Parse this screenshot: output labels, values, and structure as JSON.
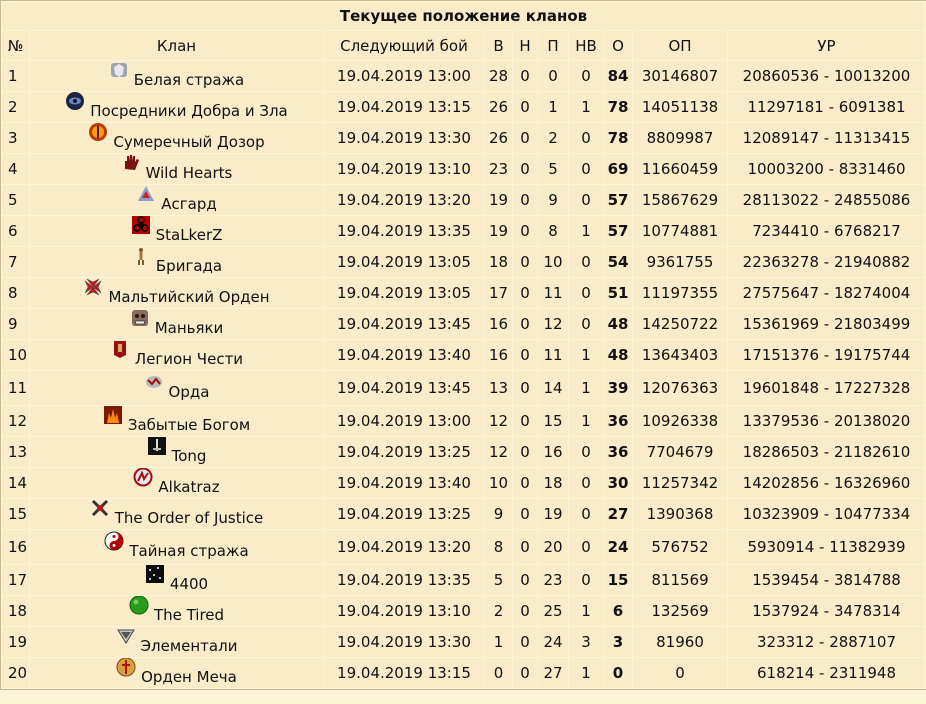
{
  "title": "Текущее положение кланов",
  "headers": [
    "№",
    "Клан",
    "Следующий бой",
    "В",
    "Н",
    "П",
    "НВ",
    "О",
    "ОП",
    "УР"
  ],
  "rows": [
    {
      "n": "1",
      "icon": "shield-icon",
      "clan": "Белая стража",
      "date": "19.04.2019 13:00",
      "w": "28",
      "d": "0",
      "l": "0",
      "nv": "0",
      "o": "84",
      "op": "30146807",
      "ur": "20860536 - 10013200"
    },
    {
      "n": "2",
      "icon": "eye-icon",
      "clan": "Посредники Добра и Зла",
      "date": "19.04.2019 13:15",
      "w": "26",
      "d": "0",
      "l": "1",
      "nv": "1",
      "o": "78",
      "op": "14051138",
      "ur": "11297181 - 6091381"
    },
    {
      "n": "3",
      "icon": "flame-circle-icon",
      "clan": "Сумеречный Дозор",
      "date": "19.04.2019 13:30",
      "w": "26",
      "d": "0",
      "l": "2",
      "nv": "0",
      "o": "78",
      "op": "8809987",
      "ur": "12089147 - 11313415"
    },
    {
      "n": "4",
      "icon": "hand-icon",
      "clan": "Wild Hearts",
      "date": "19.04.2019 13:10",
      "w": "23",
      "d": "0",
      "l": "5",
      "nv": "0",
      "o": "69",
      "op": "11660459",
      "ur": "10003200 - 8331460"
    },
    {
      "n": "5",
      "icon": "pyramid-icon",
      "clan": "Асгард",
      "date": "19.04.2019 13:20",
      "w": "19",
      "d": "0",
      "l": "9",
      "nv": "0",
      "o": "57",
      "op": "15867629",
      "ur": "28113022 - 24855086"
    },
    {
      "n": "6",
      "icon": "biohazard-icon",
      "clan": "StaLkerZ",
      "date": "19.04.2019 13:35",
      "w": "19",
      "d": "0",
      "l": "8",
      "nv": "1",
      "o": "57",
      "op": "10774881",
      "ur": "7234410 - 6768217"
    },
    {
      "n": "7",
      "icon": "figure-icon",
      "clan": "Бригада",
      "date": "19.04.2019 13:05",
      "w": "18",
      "d": "0",
      "l": "10",
      "nv": "0",
      "o": "54",
      "op": "9361755",
      "ur": "22363278 - 21940882"
    },
    {
      "n": "8",
      "icon": "maltese-cross-icon",
      "clan": "Мальтийский Орден",
      "date": "19.04.2019 13:05",
      "w": "17",
      "d": "0",
      "l": "11",
      "nv": "0",
      "o": "51",
      "op": "11197355",
      "ur": "27575647 - 18274004"
    },
    {
      "n": "9",
      "icon": "mask-icon",
      "clan": "Маньяки",
      "date": "19.04.2019 13:45",
      "w": "16",
      "d": "0",
      "l": "12",
      "nv": "0",
      "o": "48",
      "op": "14250722",
      "ur": "15361969 - 21803499"
    },
    {
      "n": "10",
      "icon": "banner-icon",
      "clan": "Легион Чести",
      "date": "19.04.2019 13:40",
      "w": "16",
      "d": "0",
      "l": "11",
      "nv": "1",
      "o": "48",
      "op": "13643403",
      "ur": "17151376 - 19175744"
    },
    {
      "n": "11",
      "icon": "horde-icon",
      "clan": "Орда",
      "date": "19.04.2019 13:45",
      "w": "13",
      "d": "0",
      "l": "14",
      "nv": "1",
      "o": "39",
      "op": "12076363",
      "ur": "19601848 - 17227328"
    },
    {
      "n": "12",
      "icon": "fire-icon",
      "clan": "Забытые Богом",
      "date": "19.04.2019 13:00",
      "w": "12",
      "d": "0",
      "l": "15",
      "nv": "1",
      "o": "36",
      "op": "10926338",
      "ur": "13379536 - 20138020"
    },
    {
      "n": "13",
      "icon": "sword-icon",
      "clan": "Tong",
      "date": "19.04.2019 13:25",
      "w": "12",
      "d": "0",
      "l": "16",
      "nv": "0",
      "o": "36",
      "op": "7704679",
      "ur": "18286503 - 21182610"
    },
    {
      "n": "14",
      "icon": "alkatraz-icon",
      "clan": "Alkatraz",
      "date": "19.04.2019 13:40",
      "w": "10",
      "d": "0",
      "l": "18",
      "nv": "0",
      "o": "30",
      "op": "11257342",
      "ur": "14202856 - 16326960"
    },
    {
      "n": "15",
      "icon": "cross-swords-icon",
      "clan": "The Order of Justice",
      "date": "19.04.2019 13:25",
      "w": "9",
      "d": "0",
      "l": "19",
      "nv": "0",
      "o": "27",
      "op": "1390368",
      "ur": "10323909 - 10477334"
    },
    {
      "n": "16",
      "icon": "yin-yang-icon",
      "clan": "Тайная стража",
      "date": "19.04.2019 13:20",
      "w": "8",
      "d": "0",
      "l": "20",
      "nv": "0",
      "o": "24",
      "op": "576752",
      "ur": "5930914 - 11382939"
    },
    {
      "n": "17",
      "icon": "stars-icon",
      "clan": "4400",
      "date": "19.04.2019 13:35",
      "w": "5",
      "d": "0",
      "l": "23",
      "nv": "0",
      "o": "15",
      "op": "811569",
      "ur": "1539454 - 3814788"
    },
    {
      "n": "18",
      "icon": "green-ball-icon",
      "clan": "The Tired",
      "date": "19.04.2019 13:10",
      "w": "2",
      "d": "0",
      "l": "25",
      "nv": "1",
      "o": "6",
      "op": "132569",
      "ur": "1537924 - 3478314"
    },
    {
      "n": "19",
      "icon": "chevron-emblem-icon",
      "clan": "Элементали",
      "date": "19.04.2019 13:30",
      "w": "1",
      "d": "0",
      "l": "24",
      "nv": "3",
      "o": "3",
      "op": "81960",
      "ur": "323312 - 2887107"
    },
    {
      "n": "20",
      "icon": "sword-shield-icon",
      "clan": "Орден Меча",
      "date": "19.04.2019 13:15",
      "w": "0",
      "d": "0",
      "l": "27",
      "nv": "1",
      "o": "0",
      "op": "0",
      "ur": "618214 - 2311948"
    }
  ],
  "colors": {
    "background": "#fdf5d8",
    "cell": "#faecc8",
    "border": "#c9b991"
  }
}
